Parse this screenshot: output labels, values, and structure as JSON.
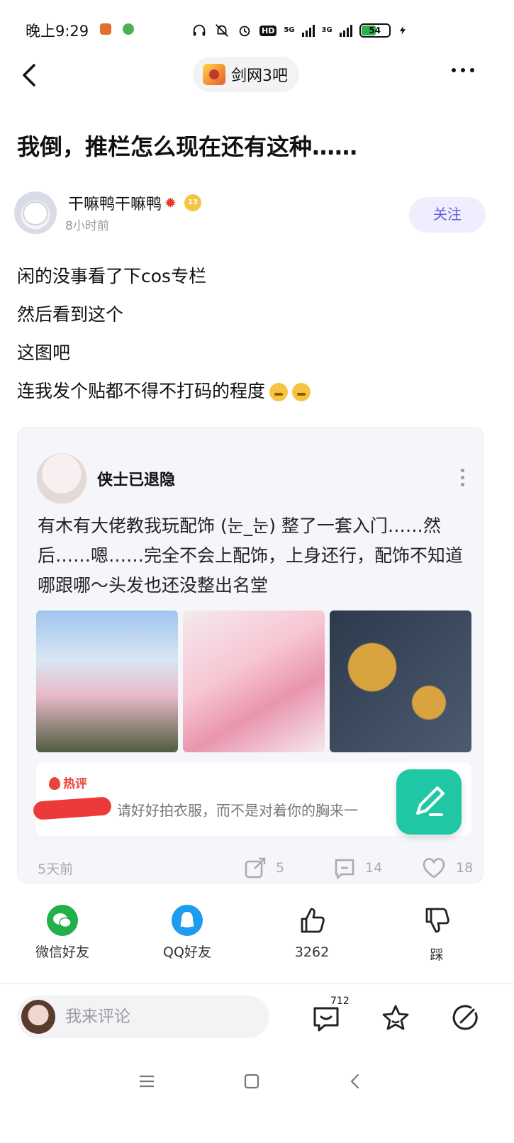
{
  "status_bar": {
    "time": "晚上9:29",
    "hd_label": "HD",
    "net1": "5G",
    "net2": "3G",
    "battery": "54",
    "battery_fraction": 0.54
  },
  "nav": {
    "forum_name": "剑网3吧"
  },
  "post": {
    "title": "我倒，推栏怎么现在还有这种……",
    "author": "干嘛鸭干嘛鸭",
    "level": "13",
    "time": "8小时前",
    "follow_label": "关注",
    "lines": [
      "闲的没事看了下cos专栏",
      "然后看到这个",
      "这图吧",
      "连我发个贴都不得不打码的程度"
    ]
  },
  "embed": {
    "author": "侠士已退隐",
    "text": "有木有大佬教我玩配饰 (눈_눈) 整了一套入门……然后……嗯……完全不会上配饰，上身还行，配饰不知道哪跟哪～头发也还没整出名堂",
    "hot_label": "热评",
    "hot_text": "请好好拍衣服，而不是对着你的胸来一",
    "time": "5天前",
    "shares": "5",
    "comments": "14",
    "likes": "18"
  },
  "share": {
    "wechat": "微信好友",
    "qq": "QQ好友",
    "like_count": "3262",
    "dislike": "踩"
  },
  "comment_bar": {
    "placeholder": "我来评论",
    "comment_count": "712"
  },
  "colors": {
    "follow_text": "#6b5bd9",
    "fab": "#1fc7a5",
    "hot": "#e9443b"
  }
}
